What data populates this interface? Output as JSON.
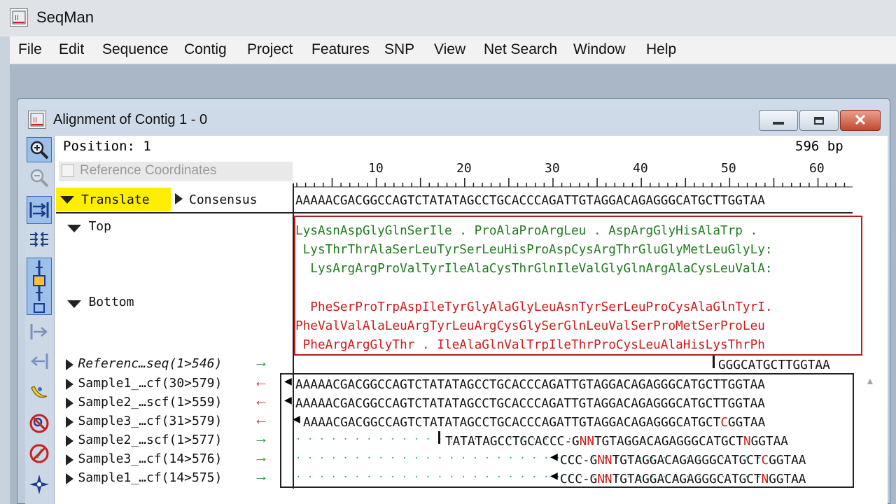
{
  "app": {
    "title": "SeqMan"
  },
  "menu": [
    "File",
    "Edit",
    "Sequence",
    "Contig",
    "Project",
    "Features",
    "SNP",
    "View",
    "Net Search",
    "Window",
    "Help"
  ],
  "window": {
    "title": "Alignment of Contig 1 - 0"
  },
  "info": {
    "position": "Position: 1",
    "length": "596 bp",
    "ref_coords_label": "Reference Coordinates",
    "ref_coords_checked": false
  },
  "ruler": {
    "ticks": [
      "10",
      "20",
      "30",
      "40",
      "50",
      "60"
    ]
  },
  "translate_label": "Translate",
  "consensus": {
    "label": "Consensus",
    "sequence": "AAAAACGACGGCCAGTCTATATAGCCTGCACCCAGATTGTAGGACAGAGGGCATGCTTGGTAA"
  },
  "translation": {
    "top_label": "Top",
    "bottom_label": "Bottom",
    "top_frames": [
      "LysAsnAspGlyGlnSerIle . ProAlaProArgLeu . AspArgGlyHisAlaTrp .",
      " LysThrThrAlaSerLeuTyrSerLeuHisProAspCysArgThrGluGlyMetLeuGlyLy:",
      "  LysArgArgProValTyrIleAlaCysThrGlnIleValGlyGlnArgAlaCysLeuValA:"
    ],
    "bottom_frames": [
      "  PheSerProTrpAspIleTyrGlyAlaGlyLeuAsnTyrSerLeuProCysAlaGlnTyrI.",
      "PheValValAlaLeuArgTyrLeuArgCysGlySerGlnLeuValSerProMetSerProLeu",
      " PheArgArgGlyThr . IleAlaGlnValTrpIleThrProCysLeuAlaHisLysThrPh"
    ]
  },
  "reads": [
    {
      "name": "Referenc…seq(1>546)",
      "italic": true,
      "dir": "→",
      "seq": "GGGCATGCTTGGTAA"
    },
    {
      "name": "Sample1_…cf(30>579)",
      "dir": "←",
      "seq": "AAAAACGACGGCCAGTCTATATAGCCTGCACCCAGATTGTAGGACAGAGGGCATGCTTGGTAA"
    },
    {
      "name": "Sample2_…scf(1>559)",
      "dir": "←",
      "seq": "AAAAACGACGGCCAGTCTATATAGCCTGCACCCAGATTGTAGGACAGAGGGCATGCTTGGTAA"
    },
    {
      "name": "Sample3_…cf(31>579)",
      "dir": "←",
      "seq_a": "AAAACGACGGCCAGTCTATATAGCCTGCACCCAGATTGTAGGACAGAGGGCATGCT",
      "seq_b": "C",
      "seq_c": "GGTAA"
    },
    {
      "name": "Sample2_…scf(1>577)",
      "dir": "→",
      "dots": "· · · · · · · · · · · · · · · · · · · · · · · ·",
      "seq_a": "TATATAGCCTGCACCC-G",
      "seq_b": "NN",
      "seq_c": "TGTAGGACAGAGGGCATGCT",
      "seq_d": "N",
      "seq_e": "GGTAA"
    },
    {
      "name": "Sample3_…cf(14>576)",
      "dir": "→",
      "dots": "· · · · · · · · · · · · · · · · · · · · · · · · · · · · · · · · · · · · · · · ·",
      "seq_a": "CCC-G",
      "seq_b": "NN",
      "seq_c": "TGTAGGACAGAGGGCATGCT",
      "seq_d": "C",
      "seq_e": "GGTAA"
    },
    {
      "name": "Sample1_…cf(14>575)",
      "dir": "→",
      "dots": "· · · · · · · · · · · · · · · · · · · · · · · · · · · · · · · · · · · · · · · ·",
      "seq_a": "CCC-G",
      "seq_b": "NN",
      "seq_c": "TGTAGGACAGAGGGCATGCT",
      "seq_d": "N",
      "seq_e": "GGTAA"
    }
  ],
  "colors": {
    "forward_arrow": "#2a9a3a",
    "reverse_arrow": "#cc2a2a",
    "top_frames": "#1f7a1f",
    "bottom_frames": "#d01818",
    "highlight": "#ffee00",
    "selection_box": "#b81c1c"
  },
  "toolbar_icons": [
    "zoom-in-icon",
    "zoom-out-icon",
    "expand-icon",
    "compress-icon",
    "slider-icon",
    "move-right-icon",
    "move-left-icon",
    "banana-icon",
    "no-search-icon",
    "no-edit-icon",
    "compass-icon"
  ]
}
